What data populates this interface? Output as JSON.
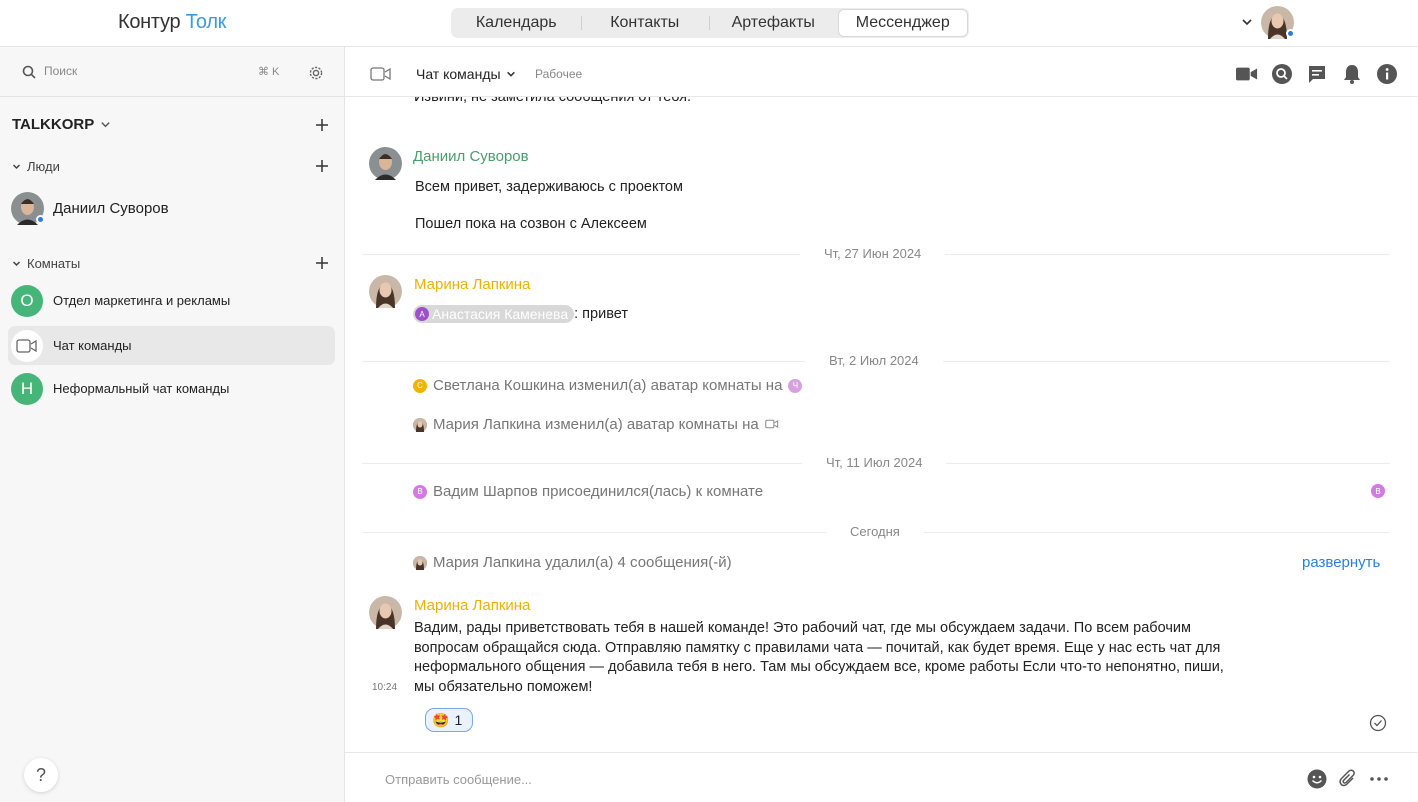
{
  "app": {
    "logo_part1": "Контур",
    "logo_part2": "Толк"
  },
  "nav": {
    "tabs": [
      {
        "label": "Календарь"
      },
      {
        "label": "Контакты"
      },
      {
        "label": "Артефакты"
      },
      {
        "label": "Мессенджер",
        "active": true
      }
    ]
  },
  "sidebar": {
    "search_placeholder": "Поиск",
    "search_shortcut": "⌘ K",
    "workspace": "TALKKORP",
    "people_header": "Люди",
    "people": [
      {
        "name": "Даниил Суворов"
      }
    ],
    "rooms_header": "Комнаты",
    "rooms": [
      {
        "name": "Отдел маркетинга и рекламы",
        "initial": "О",
        "color": "#45b57a"
      },
      {
        "name": "Чат команды",
        "active": true
      },
      {
        "name": "Неформальный чат команды",
        "initial": "Н",
        "color": "#45b57a"
      }
    ],
    "help": "?"
  },
  "chat": {
    "title": "Чат команды",
    "subtitle": "Рабочее",
    "cut_message": "Извини, не заметила сообщения от тебя.",
    "messages": [
      {
        "author": "Даниил Суворов",
        "lines": [
          "Всем привет, задерживаюсь с проектом",
          "Пошел пока на созвон с Алексеем"
        ]
      },
      {
        "author": "Марина Лапкина",
        "mention": "Анастасия Каменева",
        "mention_initial": "А",
        "text": ": привет"
      }
    ],
    "dates": [
      "Чт, 27 Июн 2024",
      "Вт, 2 Июл 2024",
      "Чт, 11 Июл 2024",
      "Сегодня"
    ],
    "system": [
      {
        "text": "Светлана Кошкина изменил(а) аватар комнаты на",
        "initial": "С",
        "color": "#f2b400",
        "target_initial": "Ч"
      },
      {
        "text": "Мария Лапкина изменил(а) аватар комнаты на"
      },
      {
        "text": "Вадим Шарпов присоединился(лась) к комнате",
        "initial": "В",
        "color": "#d47be3"
      },
      {
        "text": "Мария Лапкина удалил(а) 4 сообщения(-й)"
      }
    ],
    "expand_label": "развернуть",
    "last_message": {
      "author": "Марина Лапкина",
      "time": "10:24",
      "lines": [
        "Вадим, рады приветствовать тебя в нашей команде! Это рабочий чат, где мы обсуждаем задачи. По всем рабочим",
        "вопросам обращайся сюда. Отправляю памятку с правилами чата — почитай, как будет время. Еще у нас есть чат для",
        "неформального общения — добавила тебя в него. Там мы обсуждаем все, кроме работы  Если что-то непонятно, пиши,",
        "мы обязательно поможем!"
      ],
      "reaction_emoji": "🤩",
      "reaction_count": "1"
    },
    "composer_placeholder": "Отправить сообщение..."
  },
  "colors": {
    "accent": "#2d7de0",
    "green_author": "#4a9d6c",
    "gold_author": "#e9b300",
    "room_green": "#45b57a"
  }
}
